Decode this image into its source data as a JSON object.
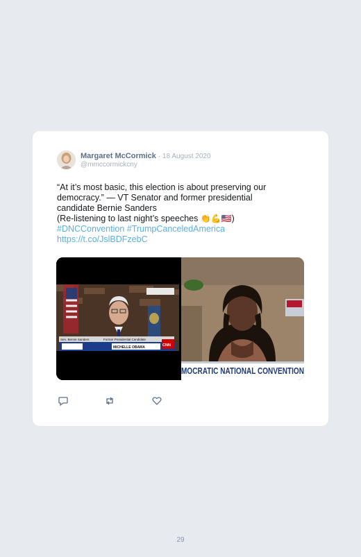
{
  "tweet": {
    "author_name": "Margaret McCormick",
    "date": "· 18 August 2020",
    "handle": "@mmccormickcny",
    "line1": "“At it’s most basic, this election is about preserving our",
    "line2": "democracy.” — VT Senator and former presidential",
    "line3": "candidate Bernie Sanders",
    "line4_prefix": "(Re-listening to last night’s speeches ",
    "emojis": "👏💪🇺🇸",
    "line4_suffix": ")",
    "hashtag1": "#DNCConvention",
    "hashtag2": "#TrumpCanceledAmerica",
    "url": "https://t.co/JslBDFzebC",
    "media": {
      "left_caption": "Sen. Bernie Sanders",
      "left_lower": "Former Presidential Candidate",
      "left_name_tag": "MICHELLE OBAMA",
      "left_logo": "CNN",
      "right_banner": "MOCRATIC NATIONAL CONVENTION"
    }
  },
  "actions": {
    "reply_icon": "reply-icon",
    "retweet_icon": "retweet-icon",
    "like_icon": "heart-icon"
  },
  "page_number": "29",
  "colors": {
    "background": "#e7ebf0",
    "card": "#ffffff",
    "name": "#5b6f8c",
    "muted": "#a6b0bd",
    "link": "#5aaee8"
  }
}
